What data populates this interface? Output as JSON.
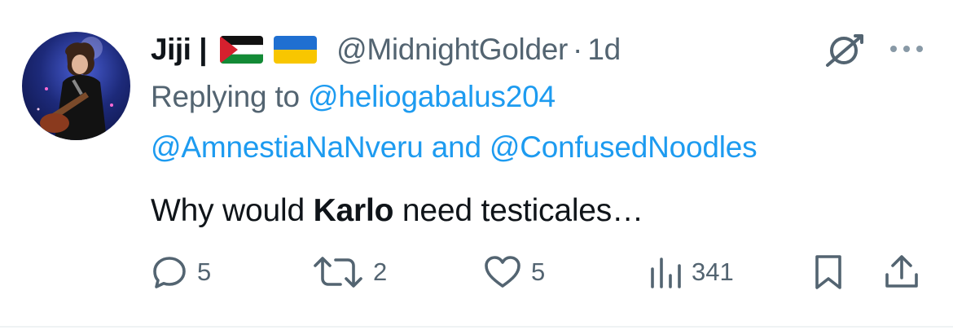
{
  "tweet": {
    "author_name": "Jiji |",
    "flags": [
      "palestine-flag",
      "ukraine-flag"
    ],
    "handle": "@MidnightGolder",
    "separator": "·",
    "timestamp": "1d",
    "replying_prefix": "Replying to",
    "mentions": [
      "@heliogabalus204",
      "@AmnestiaNaNveru",
      "@ConfusedNoodles"
    ],
    "mentions_joiner": "and",
    "body_before": "Why would ",
    "body_bold": "Karlo",
    "body_after": " need testicales…"
  },
  "actions": {
    "replies": "5",
    "reposts": "2",
    "likes": "5",
    "views": "341"
  },
  "colors": {
    "accent": "#1d9bf0",
    "secondary_text": "#536471",
    "primary_text": "#0f1419",
    "border": "#eff3f4"
  },
  "icons": [
    "grok-icon",
    "more-icon",
    "reply-icon",
    "repost-icon",
    "like-icon",
    "views-icon",
    "bookmark-icon",
    "share-icon"
  ]
}
